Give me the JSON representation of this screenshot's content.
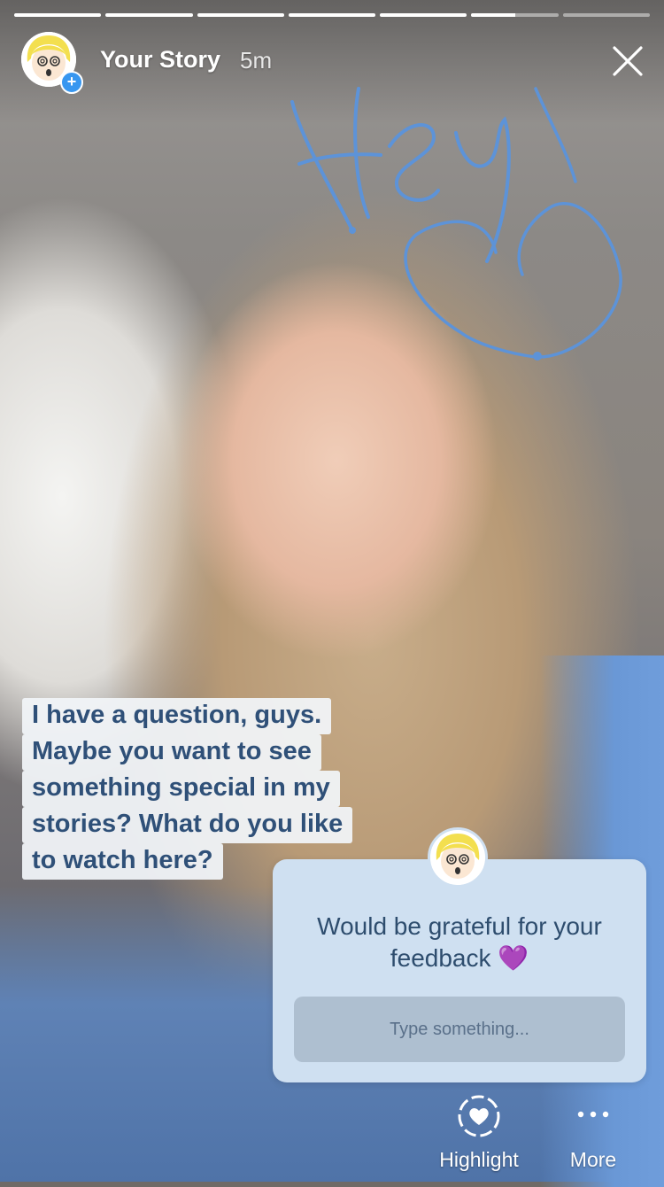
{
  "story": {
    "username": "Your Story",
    "time_ago": "5m",
    "progress_segments": [
      1,
      1,
      1,
      1,
      1,
      0.5,
      0
    ],
    "doodle_text": "Hey"
  },
  "caption": {
    "lines": [
      "I have a question, guys.",
      "Maybe you want to see",
      "something special in my",
      "stories? What do you like",
      "to watch here?"
    ]
  },
  "question_sticker": {
    "prompt_line1": "Would be grateful for your",
    "prompt_line2": "feedback 💜",
    "input_placeholder": "Type something..."
  },
  "actions": {
    "highlight_label": "Highlight",
    "more_label": "More"
  },
  "colors": {
    "badge": "#3897f0",
    "sticker_bg": "#cfe0f1",
    "caption_text": "#2f5078",
    "doodle": "#5d93d8"
  },
  "icons": [
    "close-icon",
    "add-icon",
    "highlight-heart-icon",
    "more-dots-icon"
  ]
}
